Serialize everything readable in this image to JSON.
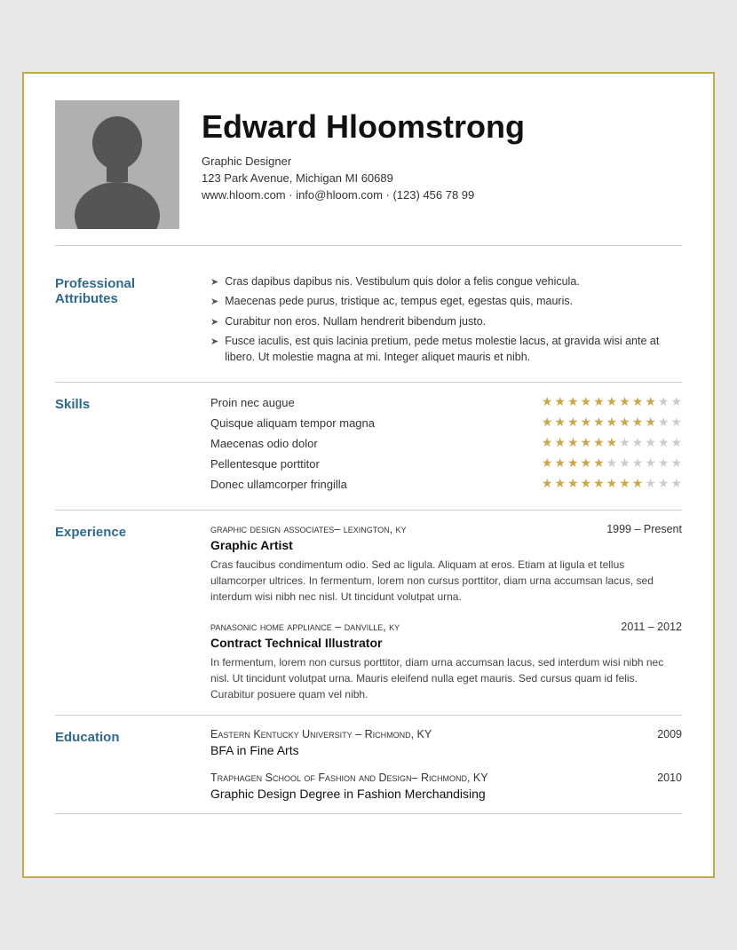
{
  "header": {
    "name": "Edward Hloomstrong",
    "title": "Graphic Designer",
    "address": "123 Park Avenue, Michigan MI 60689",
    "contact": "www.hloom.com · info@hloom.com · (123) 456 78 99"
  },
  "professional_attributes": {
    "label": "Professional Attributes",
    "items": [
      "Cras dapibus dapibus nis. Vestibulum quis dolor a felis congue vehicula.",
      "Maecenas pede purus, tristique ac, tempus eget, egestas quis, mauris.",
      "Curabitur non eros. Nullam hendrerit bibendum justo.",
      "Fusce iaculis, est quis lacinia pretium, pede metus molestie lacus, at gravida wisi ante at libero. Ut molestie magna at mi. Integer aliquet mauris et nibh."
    ]
  },
  "skills": {
    "label": "Skills",
    "items": [
      {
        "name": "Proin nec augue",
        "filled": 9,
        "total": 11
      },
      {
        "name": "Quisque aliquam tempor magna",
        "filled": 9,
        "total": 11
      },
      {
        "name": "Maecenas odio dolor",
        "filled": 6,
        "total": 11
      },
      {
        "name": "Pellentesque porttitor",
        "filled": 5,
        "total": 11
      },
      {
        "name": "Donec ullamcorper fringilla",
        "filled": 8,
        "total": 11
      }
    ]
  },
  "experience": {
    "label": "Experience",
    "entries": [
      {
        "company": "Graphic Design Associates– Lexington, KY",
        "date": "1999 – Present",
        "title": "Graphic Artist",
        "description": "Cras faucibus condimentum odio. Sed ac ligula. Aliquam at eros. Etiam at ligula et tellus ullamcorper ultrices. In fermentum, lorem non cursus porttitor, diam urna accumsan lacus, sed interdum wisi nibh nec nisl. Ut tincidunt volutpat urna."
      },
      {
        "company": "Panasonic Home Appliance – Danville, KY",
        "date": "2011 – 2012",
        "title": "Contract Technical Illustrator",
        "description": "In fermentum, lorem non cursus porttitor, diam urna accumsan lacus, sed interdum wisi nibh nec nisl. Ut tincidunt volutpat urna. Mauris eleifend nulla eget mauris. Sed cursus quam id felis. Curabitur posuere quam vel nibh."
      }
    ]
  },
  "education": {
    "label": "Education",
    "entries": [
      {
        "school": "Eastern Kentucky University – Richmond, KY",
        "year": "2009",
        "degree": "BFA in Fine Arts"
      },
      {
        "school": "Traphagen School of Fashion and Design– Richmond, KY",
        "year": "2010",
        "degree": "Graphic Design Degree in Fashion Merchandising"
      }
    ]
  }
}
